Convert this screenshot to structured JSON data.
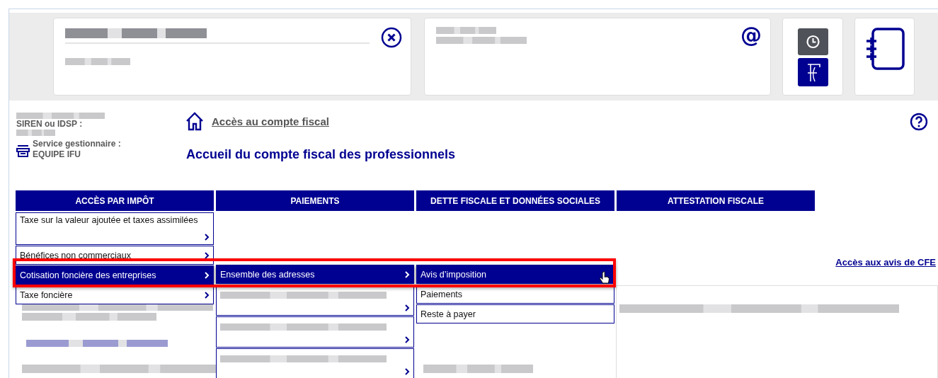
{
  "header": {
    "email_sign": "@"
  },
  "account": {
    "siren_label": "SIREN ou IDSP :",
    "service_label": "Service gestionnaire :",
    "service_value": "EQUIPE IFU"
  },
  "breadcrumb": {
    "link": "Accès au compte fiscal"
  },
  "page_title": "Accueil du compte fiscal des professionnels",
  "tabs": [
    {
      "label": "ACCÈS PAR IMPÔT"
    },
    {
      "label": "PAIEMENTS"
    },
    {
      "label": "DETTE FISCALE ET DONNÉES SOCIALES"
    },
    {
      "label": "ATTESTATION FISCALE"
    }
  ],
  "menu_level_1": [
    {
      "kind": "tall",
      "label": "Taxe sur la valeur ajoutée et taxes assimilées",
      "selected": false
    },
    {
      "kind": "line",
      "label": "Bénéfices non commerciaux",
      "selected": false
    },
    {
      "kind": "line",
      "label": "Cotisation foncière des entreprises",
      "selected": true
    },
    {
      "kind": "line",
      "label": "Taxe foncière",
      "selected": false
    }
  ],
  "menu_level_2": [
    {
      "kind": "line",
      "label": "Ensemble des adresses",
      "selected": true
    },
    {
      "kind": "blurred",
      "selected": false
    },
    {
      "kind": "blurred",
      "selected": false
    },
    {
      "kind": "blurred",
      "selected": false
    }
  ],
  "menu_level_3": [
    {
      "label": "Avis d’imposition",
      "selected": true
    },
    {
      "label": "Paiements",
      "selected": false
    },
    {
      "label": "Reste à payer",
      "selected": false
    }
  ],
  "cfe_link": "Accès aux avis de CFE"
}
